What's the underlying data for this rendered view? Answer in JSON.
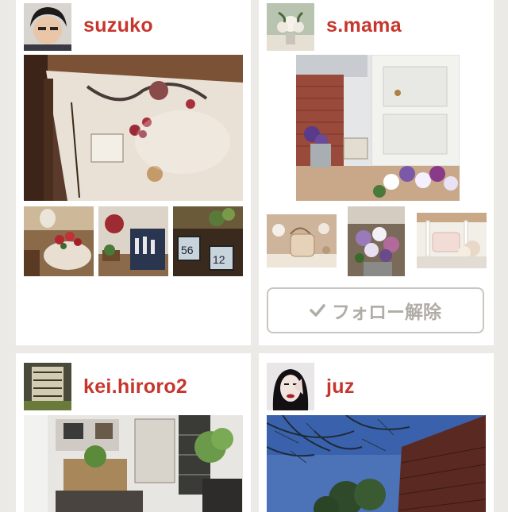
{
  "cards": [
    {
      "username": "suzuko",
      "avatar_icon": "user-photo-avatar",
      "photos": [
        "wall-decor-photo",
        "strawberry-basket-photo",
        "wall-plaque-photo",
        "number-tiles-photo"
      ]
    },
    {
      "username": "s.mama",
      "avatar_icon": "rose-bouquet-avatar",
      "photos": [
        "entrance-door-photo",
        "lace-purse-photo",
        "pansy-pot-photo",
        "white-chair-photo"
      ],
      "follow_button": {
        "label": "フォロー解除",
        "icon": "check-icon"
      }
    },
    {
      "username": "kei.hiroro2",
      "avatar_icon": "staircase-avatar",
      "photos": [
        "interior-room-photo"
      ]
    },
    {
      "username": "juz",
      "avatar_icon": "woman-portrait-avatar",
      "photos": [
        "blue-sky-tree-photo"
      ]
    }
  ],
  "colors": {
    "background": "#eceae6",
    "card": "#ffffff",
    "username": "#c7362c",
    "button_text": "#b0aca6",
    "button_border": "#c9c6c2"
  }
}
